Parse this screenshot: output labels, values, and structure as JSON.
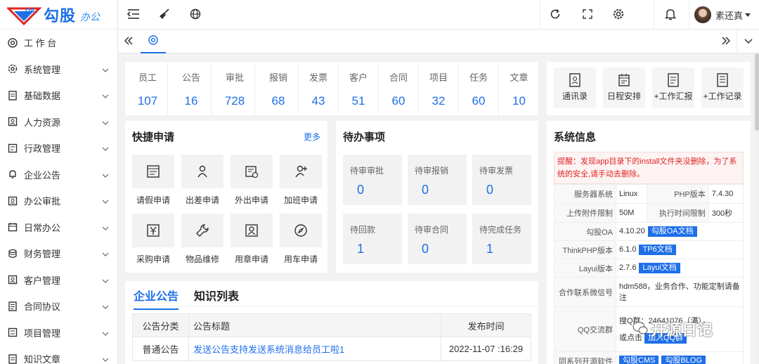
{
  "logo": {
    "mark": "OA",
    "name": "勾股",
    "sub": "办公"
  },
  "sidebar": {
    "items": [
      {
        "label": "工 作 台",
        "icon": "workbench-icon",
        "has_arrow": false
      },
      {
        "label": "系统管理",
        "icon": "system-gear-icon",
        "has_arrow": true
      },
      {
        "label": "基础数据",
        "icon": "data-icon",
        "has_arrow": true
      },
      {
        "label": "人力资源",
        "icon": "hr-icon",
        "has_arrow": true
      },
      {
        "label": "行政管理",
        "icon": "admin-icon",
        "has_arrow": true
      },
      {
        "label": "企业公告",
        "icon": "bell-icon",
        "has_arrow": true
      },
      {
        "label": "办公审批",
        "icon": "approve-icon",
        "has_arrow": true
      },
      {
        "label": "日常办公",
        "icon": "calendar-icon",
        "has_arrow": true
      },
      {
        "label": "财务管理",
        "icon": "finance-icon",
        "has_arrow": true
      },
      {
        "label": "客户管理",
        "icon": "customer-icon",
        "has_arrow": true
      },
      {
        "label": "合同协议",
        "icon": "contract-icon",
        "has_arrow": true
      },
      {
        "label": "项目管理",
        "icon": "project-icon",
        "has_arrow": true
      },
      {
        "label": "知识文章",
        "icon": "article-icon",
        "has_arrow": true
      }
    ]
  },
  "topbar": {
    "username": "素还真"
  },
  "stats": [
    {
      "label": "员工",
      "value": "107"
    },
    {
      "label": "公告",
      "value": "16"
    },
    {
      "label": "审批",
      "value": "728"
    },
    {
      "label": "报销",
      "value": "68"
    },
    {
      "label": "发票",
      "value": "43"
    },
    {
      "label": "客户",
      "value": "51"
    },
    {
      "label": "合同",
      "value": "60"
    },
    {
      "label": "项目",
      "value": "32"
    },
    {
      "label": "任务",
      "value": "60"
    },
    {
      "label": "文章",
      "value": "10"
    }
  ],
  "shortcuts": [
    {
      "label": "通讯录"
    },
    {
      "label": "日程安排"
    },
    {
      "label": "+工作汇报"
    },
    {
      "label": "+工作记录"
    }
  ],
  "apply": {
    "title": "快捷申请",
    "more": "更多",
    "items": [
      {
        "label": "请假申请"
      },
      {
        "label": "出差申请"
      },
      {
        "label": "外出申请"
      },
      {
        "label": "加班申请"
      },
      {
        "label": "采购申请"
      },
      {
        "label": "物品维修"
      },
      {
        "label": "用章申请"
      },
      {
        "label": "用车申请"
      }
    ]
  },
  "todo": {
    "title": "待办事项",
    "items": [
      {
        "label": "待审审批",
        "value": "0"
      },
      {
        "label": "待审报销",
        "value": "0"
      },
      {
        "label": "待审发票",
        "value": "0"
      },
      {
        "label": "待回款",
        "value": "1"
      },
      {
        "label": "待审合同",
        "value": "0"
      },
      {
        "label": "待完成任务",
        "value": "1"
      }
    ]
  },
  "sysinfo": {
    "title": "系统信息",
    "warning": "提醒：发现app目录下的install文件夹没删除，为了系统的安全,请手动去删除。",
    "server_os_label": "服务器系统",
    "server_os": "Linux",
    "php_label": "PHP版本",
    "php": "7.4.30",
    "upload_label": "上传附件限制",
    "upload": "50M",
    "exec_label": "执行时间限制",
    "exec": "300秒",
    "oa_label": "勾股OA",
    "oa_version": "4.10.20",
    "oa_doc": "勾股OA文档",
    "tp_label": "ThinkPHP版本",
    "tp_version": "6.1.0",
    "tp_doc": "TP6文档",
    "layui_label": "Layui版本",
    "layui_version": "2.7.6",
    "layui_doc": "Layui文档",
    "wechat_label": "合作联系微信号",
    "wechat": "hdm588，业务合作、功能定制请备注",
    "qq_label": "QQ交流群",
    "qq_line1": "搜Q群：24641076（满），",
    "qq_line2": "或点击",
    "qq_btn": "加入QQ群",
    "more_label": "同系列开源软件",
    "more_a": "勾股CMS",
    "more_b": "勾股BLOG"
  },
  "notice": {
    "tabs": [
      "企业公告",
      "知识列表"
    ],
    "columns": [
      "公告分类",
      "公告标题",
      "发布时间"
    ],
    "rows": [
      {
        "category": "普通公告",
        "title": "发送公告支持发送系统消息给员工啦1",
        "time": "2022-11-07 :16:29"
      }
    ]
  },
  "brand_watermark": "开源日记"
}
